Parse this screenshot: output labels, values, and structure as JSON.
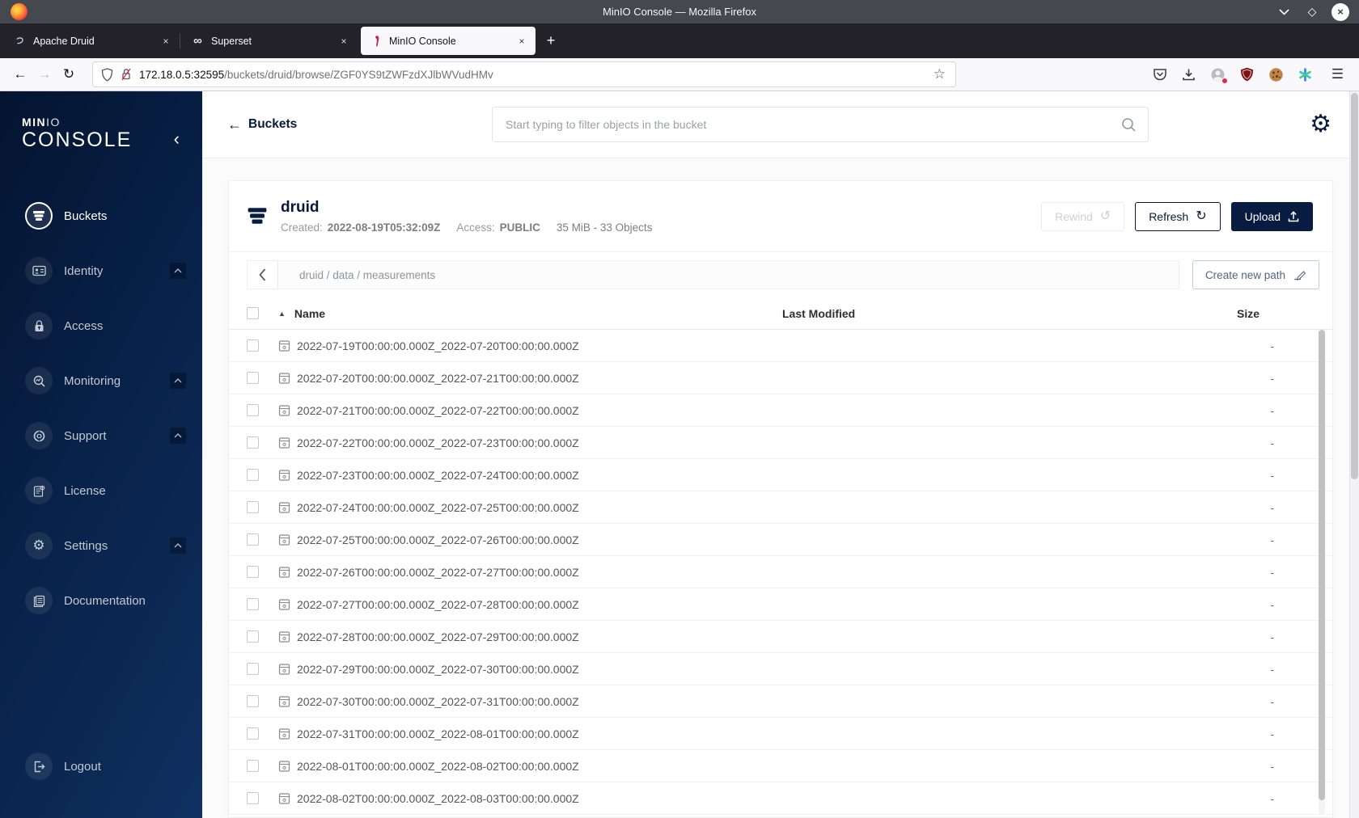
{
  "window": {
    "title": "MinIO Console — Mozilla Firefox",
    "controls": {
      "maximize_glyph": "◇",
      "close_glyph": "×"
    }
  },
  "tabs": {
    "items": [
      {
        "label": "Apache Druid",
        "close_glyph": "×"
      },
      {
        "label": "Superset",
        "close_glyph": "×"
      },
      {
        "label": "MinIO Console",
        "close_glyph": "×"
      }
    ],
    "new_tab_glyph": "+"
  },
  "urlbar": {
    "back_glyph": "←",
    "forward_glyph": "→",
    "reload_glyph": "↻",
    "host": "172.18.0.5:32595",
    "path": "/buckets/druid/browse/ZGF0YS9tZWFzdXJlbWVudHMv",
    "star_glyph": "☆",
    "menu_glyph": "☰"
  },
  "sidebar": {
    "brand_min": "MIN",
    "brand_io": "IO",
    "brand_console": "CONSOLE",
    "collapse_glyph": "‹",
    "items": [
      {
        "label": "Buckets"
      },
      {
        "label": "Identity"
      },
      {
        "label": "Access"
      },
      {
        "label": "Monitoring"
      },
      {
        "label": "Support"
      },
      {
        "label": "License"
      },
      {
        "label": "Settings"
      },
      {
        "label": "Documentation"
      }
    ],
    "logout_label": "Logout"
  },
  "page_header": {
    "back_glyph": "←",
    "back_label": "Buckets",
    "search_placeholder": "Start typing to filter objects in the bucket",
    "gear_glyph": "⚙"
  },
  "bucket": {
    "name": "druid",
    "created_label": "Created:",
    "created_value": "2022-08-19T05:32:09Z",
    "access_label": "Access:",
    "access_value": "PUBLIC",
    "stats": "35 MiB - 33 Objects",
    "rewind_label": "Rewind",
    "rewind_glyph": "↺",
    "refresh_label": "Refresh",
    "refresh_glyph": "↻",
    "upload_label": "Upload"
  },
  "path_bar": {
    "breadcrumb": "druid / data / measurements",
    "create_button_label": "Create new path"
  },
  "table": {
    "sort_glyph": "▲",
    "name_header": "Name",
    "modified_header": "Last Modified",
    "size_header": "Size",
    "rows": [
      {
        "name": "2022-07-19T00:00:00.000Z_2022-07-20T00:00:00.000Z",
        "modified": "",
        "size": "-"
      },
      {
        "name": "2022-07-20T00:00:00.000Z_2022-07-21T00:00:00.000Z",
        "modified": "",
        "size": "-"
      },
      {
        "name": "2022-07-21T00:00:00.000Z_2022-07-22T00:00:00.000Z",
        "modified": "",
        "size": "-"
      },
      {
        "name": "2022-07-22T00:00:00.000Z_2022-07-23T00:00:00.000Z",
        "modified": "",
        "size": "-"
      },
      {
        "name": "2022-07-23T00:00:00.000Z_2022-07-24T00:00:00.000Z",
        "modified": "",
        "size": "-"
      },
      {
        "name": "2022-07-24T00:00:00.000Z_2022-07-25T00:00:00.000Z",
        "modified": "",
        "size": "-"
      },
      {
        "name": "2022-07-25T00:00:00.000Z_2022-07-26T00:00:00.000Z",
        "modified": "",
        "size": "-"
      },
      {
        "name": "2022-07-26T00:00:00.000Z_2022-07-27T00:00:00.000Z",
        "modified": "",
        "size": "-"
      },
      {
        "name": "2022-07-27T00:00:00.000Z_2022-07-28T00:00:00.000Z",
        "modified": "",
        "size": "-"
      },
      {
        "name": "2022-07-28T00:00:00.000Z_2022-07-29T00:00:00.000Z",
        "modified": "",
        "size": "-"
      },
      {
        "name": "2022-07-29T00:00:00.000Z_2022-07-30T00:00:00.000Z",
        "modified": "",
        "size": "-"
      },
      {
        "name": "2022-07-30T00:00:00.000Z_2022-07-31T00:00:00.000Z",
        "modified": "",
        "size": "-"
      },
      {
        "name": "2022-07-31T00:00:00.000Z_2022-08-01T00:00:00.000Z",
        "modified": "",
        "size": "-"
      },
      {
        "name": "2022-08-01T00:00:00.000Z_2022-08-02T00:00:00.000Z",
        "modified": "",
        "size": "-"
      },
      {
        "name": "2022-08-02T00:00:00.000Z_2022-08-03T00:00:00.000Z",
        "modified": "",
        "size": "-"
      }
    ]
  },
  "colors": {
    "minio_navy": "#081C42",
    "sidebar_gradient_start": "#041430",
    "sidebar_gradient_end": "#0f3161",
    "titlebar": "#45494f",
    "tabbar": "#232229",
    "insecure_red": "#e22850",
    "ublock_red": "#7d1111"
  }
}
